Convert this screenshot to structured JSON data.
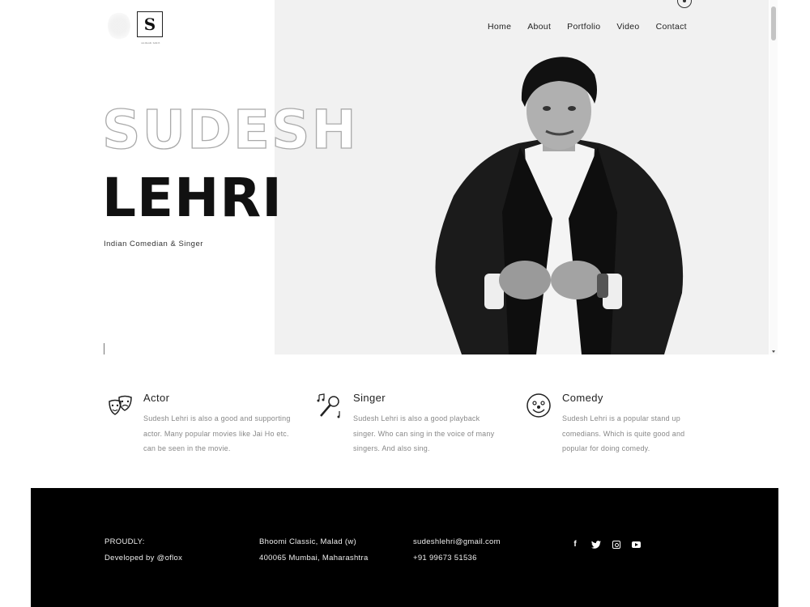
{
  "brand": {
    "monogram": "S",
    "tagline": "sudesh lehri"
  },
  "nav": {
    "items": [
      "Home",
      "About",
      "Portfolio",
      "Video",
      "Contact"
    ]
  },
  "hero": {
    "first_name": "SUDESH",
    "last_name": "LEHRI",
    "subtitle": "Indian Comedian & Singer"
  },
  "features": [
    {
      "title": "Actor",
      "text": "Sudesh Lehri is also a good and supporting actor. Many popular movies like Jai Ho etc. can be seen in the movie.",
      "icon": "theater-masks-icon"
    },
    {
      "title": "Singer",
      "text": "Sudesh Lehri is also a good playback singer. Who can sing in the voice of many singers. And also sing.",
      "icon": "microphone-music-icon"
    },
    {
      "title": "Comedy",
      "text": "Sudesh Lehri is a popular stand up comedians. Which is quite good and popular for doing comedy.",
      "icon": "clown-face-icon"
    }
  ],
  "footer": {
    "credit_line1": "PROUDLY:",
    "credit_line2": "Developed by @oflox",
    "address_line1": "Bhoomi Classic, Malad (w)",
    "address_line2": "400065 Mumbai, Maharashtra",
    "email": "sudeshlehri@gmail.com",
    "phone": "+91 99673 51536",
    "social": [
      "facebook-icon",
      "twitter-icon",
      "instagram-icon",
      "youtube-icon"
    ],
    "social_glyphs": {
      "facebook": "f",
      "twitter": "🐦"
    }
  },
  "colors": {
    "hero_bg": "#f1f1f1",
    "footer_bg": "#000000",
    "text_muted": "#888888"
  }
}
